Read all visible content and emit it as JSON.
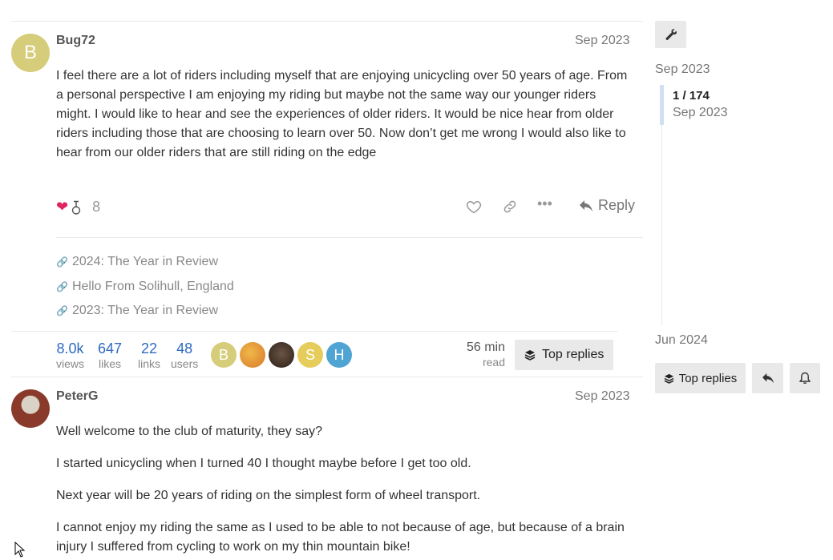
{
  "posts": [
    {
      "username": "Bug72",
      "avatar_letter": "B",
      "avatar_color": "#d6cd7a",
      "date": "Sep 2023",
      "body": [
        "I feel there are a lot of riders including myself that are enjoying unicycling over 50 years of age. From a personal perspective I am enjoying my riding but maybe not the same way our younger riders might. I would like to hear and see the experiences of older riders. It would be nice hear from older riders including those that are choosing to learn over 50. Now don’t get me wrong I would also like to hear from our older riders that are still riding on the edge"
      ],
      "like_count": "8",
      "reply_label": "Reply"
    },
    {
      "username": "PeterG",
      "date": "Sep 2023",
      "body": [
        "Well welcome to the club of maturity, they say?",
        "I started unicycling when I turned 40 I thought maybe before I get too old.",
        "Next year will be 20 years of riding on the simplest form of wheel transport.",
        "I cannot enjoy my riding the same as I used to be able to not because of age, but because of a brain injury I suffered from cycling to work on my thin mountain bike!"
      ]
    }
  ],
  "linked_topics": [
    "2024: The Year in Review",
    "Hello From Solihull, England",
    "2023: The Year in Review"
  ],
  "topic_map": {
    "views": {
      "num": "8.0k",
      "label": "views"
    },
    "likes": {
      "num": "647",
      "label": "likes"
    },
    "links": {
      "num": "22",
      "label": "links"
    },
    "users": {
      "num": "48",
      "label": "users"
    },
    "participants": [
      {
        "letter": "B",
        "color": "#d6cd7a"
      },
      {
        "letter": "",
        "color": "#e0a33a"
      },
      {
        "letter": "",
        "color": "#4a3a30"
      },
      {
        "letter": "S",
        "color": "#e6cc5a"
      },
      {
        "letter": "H",
        "color": "#4fa4d3"
      }
    ],
    "read_time": {
      "num": "56 min",
      "label": "read"
    },
    "top_replies": "Top replies"
  },
  "timeline": {
    "start_date": "Sep 2023",
    "position": "1 / 174",
    "position_date": "Sep 2023",
    "end_date": "Jun 2024",
    "top_replies": "Top replies"
  }
}
